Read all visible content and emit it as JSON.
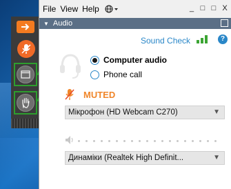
{
  "menu": {
    "file": "File",
    "view": "View",
    "help": "Help",
    "language_icon": "globe-icon"
  },
  "window_controls": {
    "minimize": "_",
    "restore": "□",
    "maximize": "□",
    "close": "X"
  },
  "panel": {
    "title": "Audio"
  },
  "sound_check": {
    "label": "Sound Check",
    "help": "?"
  },
  "audio_options": [
    {
      "label": "Computer audio",
      "selected": true
    },
    {
      "label": "Phone call",
      "selected": false
    }
  ],
  "mic": {
    "status": "MUTED",
    "device": "Мікрофон (HD Webcam C270)"
  },
  "speaker": {
    "device": "Динаміки (Realtek  High Definit..."
  },
  "colors": {
    "accent_blue": "#2a87c8",
    "muted_orange": "#f0862a",
    "highlight_green": "#2e9e2e",
    "header": "#5b6f86"
  }
}
